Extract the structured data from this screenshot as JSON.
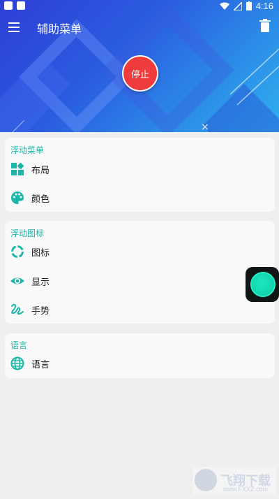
{
  "status": {
    "time": "4:16"
  },
  "toolbar": {
    "title": "辅助菜单"
  },
  "header": {
    "stop_label": "停止",
    "close_glyph": "×"
  },
  "sections": [
    {
      "title": "浮动菜单",
      "items": [
        {
          "label": "布局",
          "icon": "layout-icon"
        },
        {
          "label": "颜色",
          "icon": "palette-icon"
        }
      ]
    },
    {
      "title": "浮动图标",
      "items": [
        {
          "label": "图标",
          "icon": "circle-icon"
        },
        {
          "label": "显示",
          "icon": "eye-icon"
        },
        {
          "label": "手势",
          "icon": "gesture-icon"
        }
      ]
    },
    {
      "title": "语言",
      "items": [
        {
          "label": "语言",
          "icon": "globe-icon"
        }
      ]
    }
  ],
  "watermark": {
    "text": "飞翔下载",
    "sub": "www.FXXZ.com"
  },
  "colors": {
    "accent": "#1ab6a8",
    "stop": "#ef3b3b",
    "header_start": "#2f3fd6",
    "header_end": "#2fb0ee"
  }
}
